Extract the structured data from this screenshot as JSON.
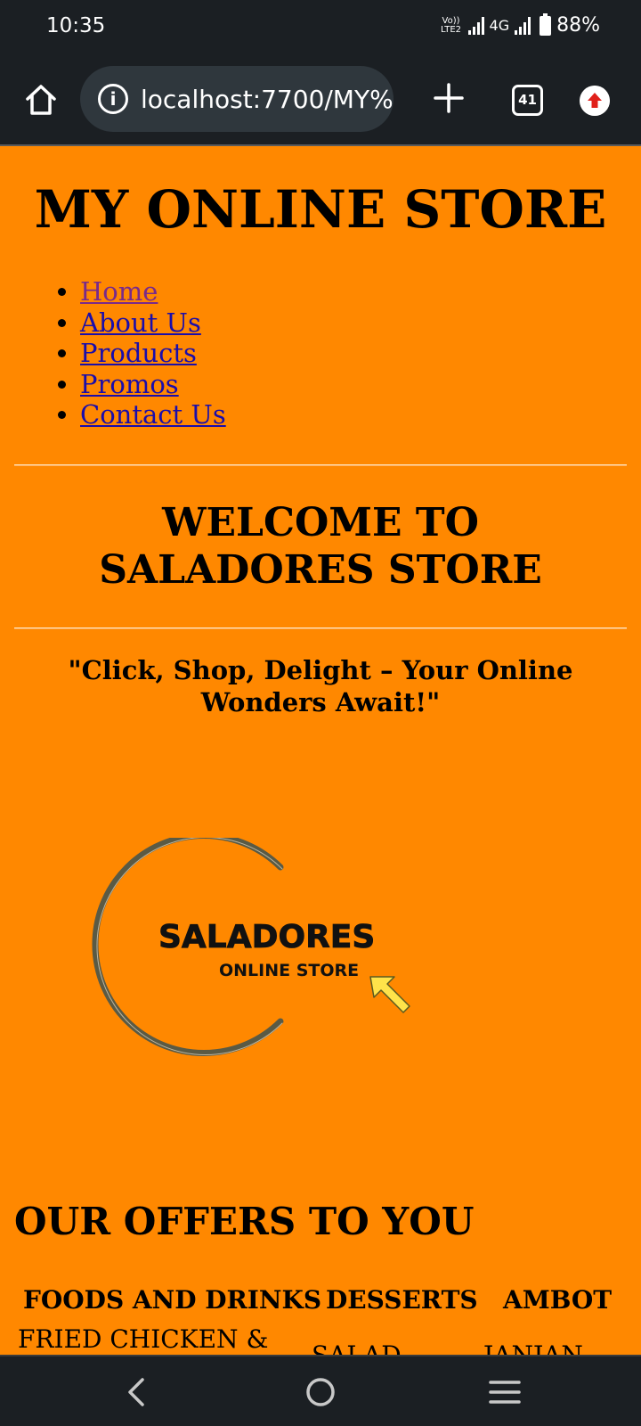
{
  "status_bar": {
    "time": "10:35",
    "volte": [
      "Vo))",
      "LTE2"
    ],
    "network": "4G",
    "battery": "88%"
  },
  "browser": {
    "url": "localhost:7700/MY%",
    "tab_count": "41",
    "icons": [
      "home-icon",
      "info-icon",
      "plus-icon",
      "tab-switcher-icon",
      "update-arrow-icon"
    ]
  },
  "site": {
    "title": "MY ONLINE STORE",
    "nav": [
      "Home",
      "About Us",
      "Products",
      "Promos",
      "Contact Us"
    ],
    "welcome": "WELCOME TO SALADORES STORE",
    "tagline": "\"Click, Shop, Delight – Your Online Wonders Await!\"",
    "logo": {
      "name": "SALADORES",
      "subtitle": "ONLINE STORE",
      "ring_color": "#5a5a44",
      "arrow_color": "#ffe34a"
    },
    "offers_title": "OUR OFFERS TO YOU",
    "offers_table": {
      "headers": [
        "FOODS AND DRINKS",
        "DESSERTS",
        "AMBOT"
      ],
      "first_row": [
        "FRIED CHICKEN &",
        "SALAD",
        "JANJAN"
      ]
    }
  },
  "colors": {
    "page_bg": "#ff8800",
    "chrome_bg": "#1b1f23",
    "link": "#1a0dab",
    "visited_link": "#7a2a8a"
  },
  "nav_bar": {
    "icons": [
      "back-icon",
      "home-circle-icon",
      "recents-icon"
    ]
  }
}
